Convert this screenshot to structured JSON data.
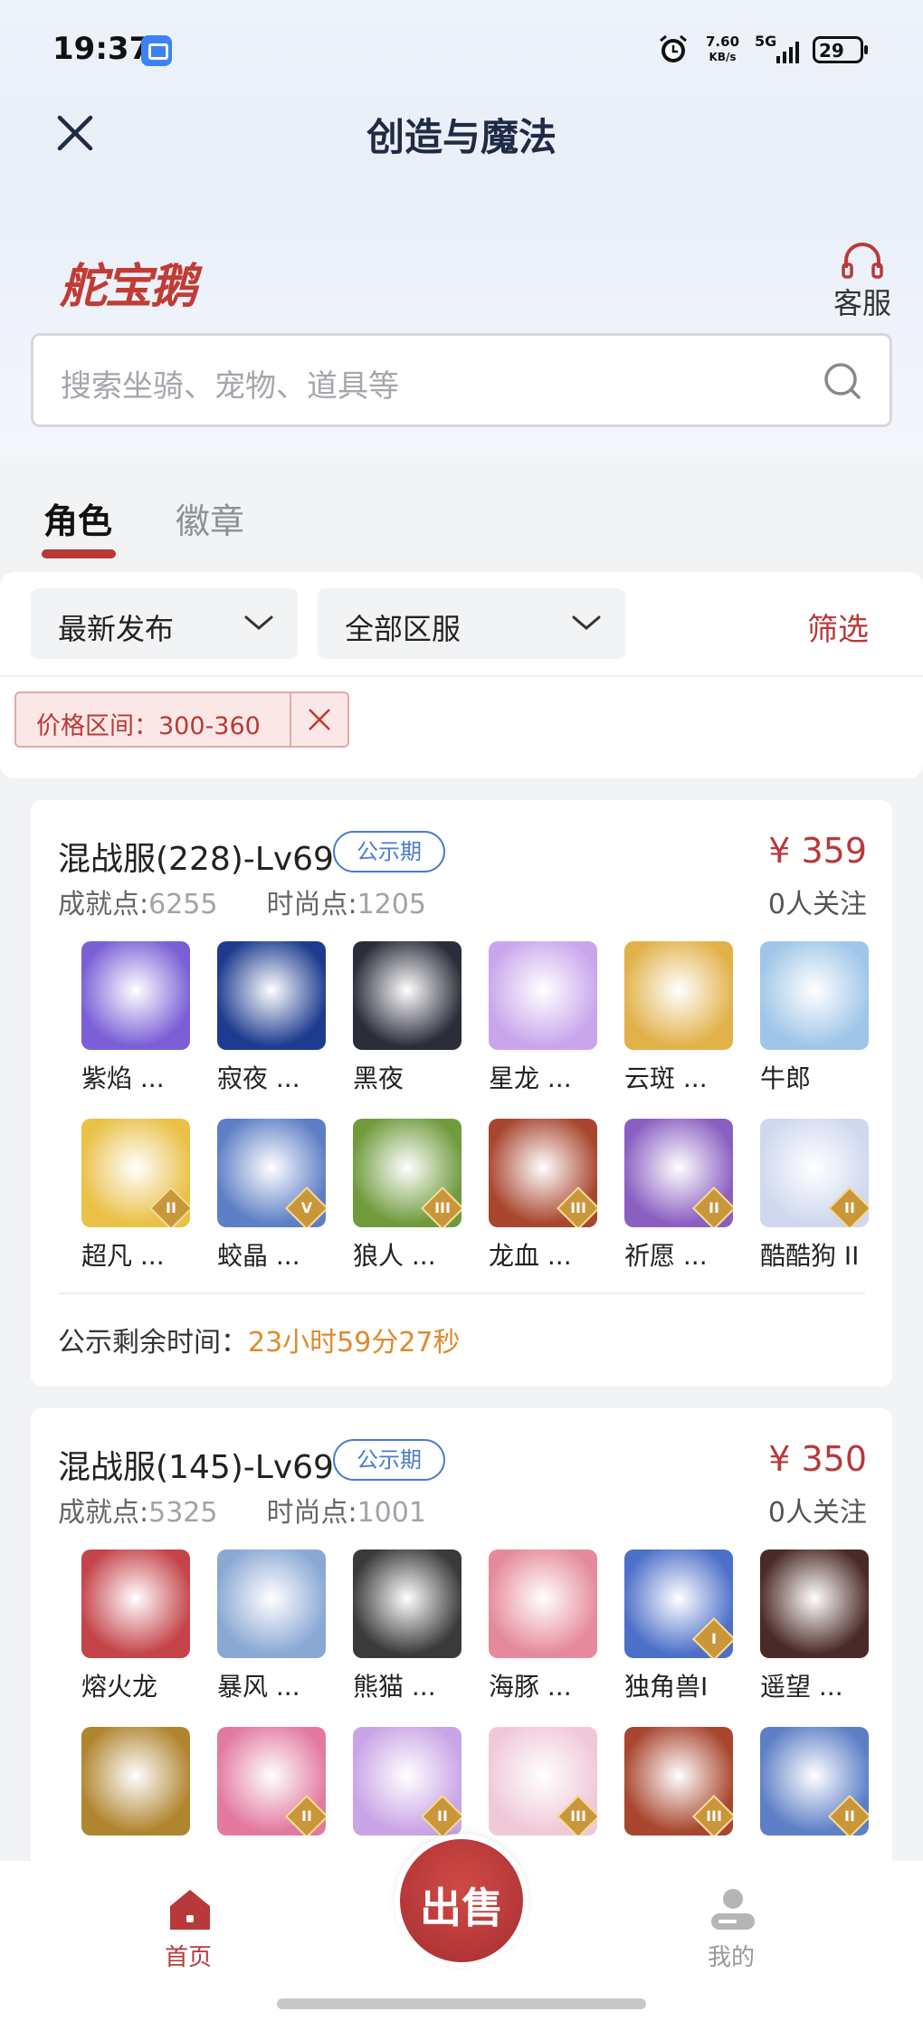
{
  "status_bar": {
    "time": "19:37",
    "speed_value": "7.60",
    "speed_unit": "KB/s",
    "network": "5G",
    "battery": "29"
  },
  "nav": {
    "title": "创造与魔法"
  },
  "header": {
    "brand": "舵宝鹅",
    "service_label": "客服"
  },
  "search": {
    "placeholder": "搜索坐骑、宠物、道具等"
  },
  "tabs": [
    {
      "label": "角色",
      "active": true
    },
    {
      "label": "徽章",
      "active": false
    }
  ],
  "filters": {
    "sort": "最新发布",
    "region": "全部区服",
    "filter_label": "筛选",
    "price_chip": "价格区间：300-360"
  },
  "listings": [
    {
      "server": "混战服(228)-Lv69",
      "tag": "公示期",
      "price": "¥ 359",
      "achievement_label": "成就点:",
      "achievement_value": "6255",
      "fashion_label": "时尚点:",
      "fashion_value": "1205",
      "followers": "0人关注",
      "pets": [
        {
          "name": "紫焰 ...",
          "color": "#7a5fd6",
          "level": ""
        },
        {
          "name": "寂夜 ...",
          "color": "#1e3c8f",
          "level": ""
        },
        {
          "name": "黑夜",
          "color": "#2b2d3a",
          "level": ""
        },
        {
          "name": "星龙 ...",
          "color": "#c9a6ec",
          "level": ""
        },
        {
          "name": "云斑 ...",
          "color": "#e2b24a",
          "level": ""
        },
        {
          "name": "牛郎",
          "color": "#9fc6e8",
          "level": ""
        },
        {
          "name": "超凡 ...",
          "color": "#e9c146",
          "level": "II"
        },
        {
          "name": "蛟晶 ...",
          "color": "#5d7fc6",
          "level": "V"
        },
        {
          "name": "狼人 ...",
          "color": "#6f9b3d",
          "level": "III"
        },
        {
          "name": "龙血 ...",
          "color": "#a8462f",
          "level": "III"
        },
        {
          "name": "祈愿 ...",
          "color": "#8b5fc2",
          "level": "II"
        },
        {
          "name": "酷酷狗 II",
          "color": "#cfd8ef",
          "level": "II"
        }
      ],
      "countdown_label": "公示剩余时间：",
      "countdown_value": "23小时59分27秒"
    },
    {
      "server": "混战服(145)-Lv69",
      "tag": "公示期",
      "price": "¥ 350",
      "achievement_label": "成就点:",
      "achievement_value": "5325",
      "fashion_label": "时尚点:",
      "fashion_value": "1001",
      "followers": "0人关注",
      "pets": [
        {
          "name": "熔火龙",
          "color": "#c4444a",
          "level": ""
        },
        {
          "name": "暴风 ...",
          "color": "#8aa8d4",
          "level": ""
        },
        {
          "name": "熊猫 ...",
          "color": "#3a3a3a",
          "level": ""
        },
        {
          "name": "海豚 ...",
          "color": "#e58a9a",
          "level": ""
        },
        {
          "name": "独角兽I",
          "color": "#4c6fc8",
          "level": "I"
        },
        {
          "name": "遥望 ...",
          "color": "#4a2a26",
          "level": ""
        },
        {
          "name": "",
          "color": "#b0852f",
          "level": ""
        },
        {
          "name": "",
          "color": "#e27aa0",
          "level": "II"
        },
        {
          "name": "",
          "color": "#c9a4e6",
          "level": "II"
        },
        {
          "name": "",
          "color": "#f0c9d9",
          "level": "III"
        },
        {
          "name": "",
          "color": "#a8462f",
          "level": "III"
        },
        {
          "name": "",
          "color": "#5d7fc6",
          "level": "II"
        }
      ]
    }
  ],
  "bottom_nav": {
    "home": "首页",
    "sell": "出售",
    "mine": "我的"
  },
  "colors": {
    "accent": "#b8393a",
    "tag_blue": "#4a7ccf",
    "countdown": "#e08a2b"
  }
}
